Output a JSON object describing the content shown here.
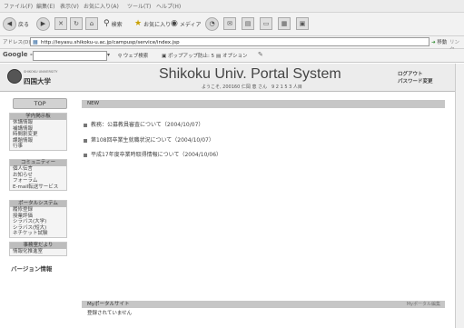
{
  "menubar": [
    "ファイル(F)",
    "編集(E)",
    "表示(V)",
    "お気に入り(A)",
    "ツール(T)",
    "ヘルプ(H)"
  ],
  "toolbar": {
    "back": "戻る",
    "search": "検索",
    "favorites": "お気に入り",
    "media": "メディア"
  },
  "address": {
    "label": "アドレス(D)",
    "url": "http://ieyasu.shikoku-u.ac.jp/campusp/service/index.jsp",
    "go": "移動",
    "links": "リンク"
  },
  "google": {
    "label": "Google -",
    "web_search": "ウェブ検索",
    "popup_blocked": "ポップアップ防止: 5",
    "options": "オプション"
  },
  "header": {
    "logo_small": "SHIKOKU UNIVERSITY",
    "logo": "四国大学",
    "title": "Shikoku Univ. Portal System",
    "welcome": "ようこそ, 200160 仁岡  恵 さん　9 2 1 5 3 人目",
    "logout": "ログアウト",
    "pw_change": "パスワード変更"
  },
  "sidebar": {
    "top": "TOP",
    "groups": [
      {
        "header": "学内掲示板",
        "items": [
          "休講情報",
          "補講情報",
          "時間割変更",
          "課題情報",
          "行事"
        ]
      },
      {
        "header": "コミュニティー",
        "items": [
          "個人伝言",
          "お知らせ",
          "フォーラム",
          "E-mail転送サービス"
        ]
      },
      {
        "header": "ポータルシステム",
        "items": [
          "履修登録",
          "授業評価",
          "シラバス(大学)",
          "シラバス(短大)",
          "ネチケット試験"
        ]
      },
      {
        "header": "事務室だより",
        "items": [
          "情報化推進室"
        ]
      }
    ],
    "version": "バージョン情報"
  },
  "main": {
    "new_label": "NEW",
    "news": [
      "教務：公募教員審査について（2004/10/07）",
      "第108回卒業生就職状況について（2004/10/07）",
      "平成17年度卒業時取得情報について（2004/10/06）"
    ],
    "portal_site_label": "Myポータルサイト",
    "portal_link": "Myポータル編集",
    "portal_empty": "登録されていません"
  }
}
